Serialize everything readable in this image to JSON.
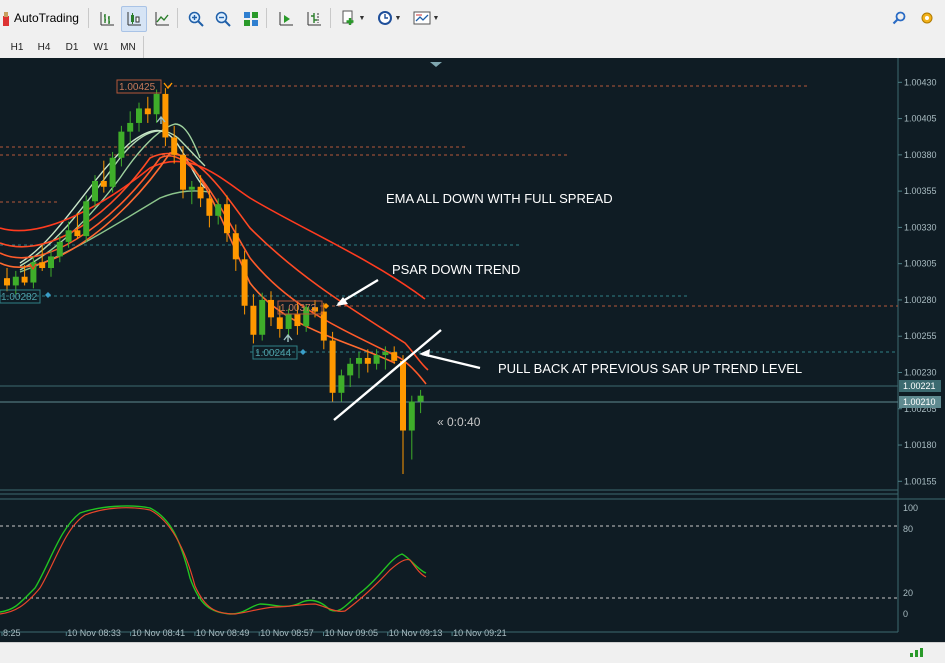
{
  "toolbar": {
    "autotrading_label": "AutoTrading"
  },
  "timeframes": [
    "H1",
    "H4",
    "D1",
    "W1",
    "MN"
  ],
  "colors": {
    "background": "#0f1c24",
    "bull": "#3fae2a",
    "bear": "#ff9800",
    "ema_red": "#ff3b1f",
    "ema_green": "#a8d8a8",
    "level_orange": "#b5593a",
    "level_teal": "#2f7f86",
    "stoch_main": "#22c322",
    "stoch_signal": "#e8462a"
  },
  "annotations": {
    "ema": "EMA ALL DOWN  WITH FULL SPREAD",
    "psar": "PSAR DOWN TREND",
    "pullback": "PULL BACK AT PREVIOUS SAR UP TREND LEVEL"
  },
  "timer": "« 0:0:40",
  "price_labels": {
    "high": "1.00425",
    "mid": "1.00373",
    "low": "1.00244",
    "left": "1.00282"
  },
  "chart_data": {
    "type": "candlestick",
    "price_ticks": [
      "1.00430",
      "1.00405",
      "1.00380",
      "1.00355",
      "1.00330",
      "1.00305",
      "1.00280",
      "1.00255",
      "1.00230",
      "1.00205",
      "1.00180",
      "1.00155"
    ],
    "price_range": [
      1.00149,
      1.00444
    ],
    "current_prices": [
      "1.00221",
      "1.00210"
    ],
    "time_labels": [
      "8:25",
      "10 Nov 08:33",
      "10 Nov 08:41",
      "10 Nov 08:49",
      "10 Nov 08:57",
      "10 Nov 09:05",
      "10 Nov 09:13",
      "10 Nov 09:21"
    ],
    "stoch_ticks": [
      "100",
      "80",
      "20",
      "0"
    ],
    "stoch_levels": [
      80,
      20
    ],
    "candles": [
      [
        1.00295,
        1.00302,
        1.00286,
        1.0029
      ],
      [
        1.0029,
        1.003,
        1.00284,
        1.00296
      ],
      [
        1.00296,
        1.00304,
        1.0029,
        1.00292
      ],
      [
        1.00292,
        1.0031,
        1.00288,
        1.00306
      ],
      [
        1.00306,
        1.00318,
        1.003,
        1.00302
      ],
      [
        1.00302,
        1.00314,
        1.00296,
        1.0031
      ],
      [
        1.0031,
        1.00324,
        1.00306,
        1.0032
      ],
      [
        1.0032,
        1.00334,
        1.00316,
        1.00328
      ],
      [
        1.00328,
        1.0034,
        1.00322,
        1.00324
      ],
      [
        1.00324,
        1.00352,
        1.0032,
        1.00348
      ],
      [
        1.00348,
        1.00366,
        1.00344,
        1.00362
      ],
      [
        1.00362,
        1.00376,
        1.00354,
        1.00358
      ],
      [
        1.00358,
        1.00382,
        1.00354,
        1.00378
      ],
      [
        1.00378,
        1.004,
        1.00372,
        1.00396
      ],
      [
        1.00396,
        1.0041,
        1.00388,
        1.00402
      ],
      [
        1.00402,
        1.00416,
        1.00396,
        1.00412
      ],
      [
        1.00412,
        1.0042,
        1.00402,
        1.00408
      ],
      [
        1.00408,
        1.00425,
        1.00402,
        1.00422
      ],
      [
        1.00422,
        1.00426,
        1.00386,
        1.00392
      ],
      [
        1.00392,
        1.004,
        1.00374,
        1.0038
      ],
      [
        1.0038,
        1.00386,
        1.0035,
        1.00356
      ],
      [
        1.00356,
        1.00362,
        1.00346,
        1.00358
      ],
      [
        1.00358,
        1.00366,
        1.00344,
        1.0035
      ],
      [
        1.0035,
        1.00356,
        1.0033,
        1.00338
      ],
      [
        1.00338,
        1.0035,
        1.00332,
        1.00346
      ],
      [
        1.00346,
        1.00352,
        1.0032,
        1.00326
      ],
      [
        1.00326,
        1.00332,
        1.003,
        1.00308
      ],
      [
        1.00308,
        1.00314,
        1.0027,
        1.00276
      ],
      [
        1.00276,
        1.00284,
        1.0025,
        1.00256
      ],
      [
        1.00256,
        1.00285,
        1.00252,
        1.0028
      ],
      [
        1.0028,
        1.00286,
        1.00262,
        1.00268
      ],
      [
        1.00268,
        1.00276,
        1.00254,
        1.0026
      ],
      [
        1.0026,
        1.00274,
        1.00254,
        1.0027
      ],
      [
        1.0027,
        1.00278,
        1.00256,
        1.00262
      ],
      [
        1.00262,
        1.00277,
        1.00258,
        1.00275
      ],
      [
        1.00275,
        1.0028,
        1.00268,
        1.00272
      ],
      [
        1.00272,
        1.00278,
        1.00246,
        1.00252
      ],
      [
        1.00252,
        1.00258,
        1.0021,
        1.00216
      ],
      [
        1.00216,
        1.00232,
        1.0021,
        1.00228
      ],
      [
        1.00228,
        1.0024,
        1.0022,
        1.00236
      ],
      [
        1.00236,
        1.00244,
        1.00226,
        1.0024
      ],
      [
        1.0024,
        1.00246,
        1.0023,
        1.00236
      ],
      [
        1.00236,
        1.00246,
        1.00232,
        1.00242
      ],
      [
        1.00242,
        1.00248,
        1.00232,
        1.00244
      ],
      [
        1.00244,
        1.00248,
        1.00236,
        1.00238
      ],
      [
        1.00238,
        1.00242,
        1.0016,
        1.0019
      ],
      [
        1.0019,
        1.00214,
        1.0017,
        1.0021
      ],
      [
        1.0021,
        1.00218,
        1.00202,
        1.00214
      ]
    ]
  }
}
